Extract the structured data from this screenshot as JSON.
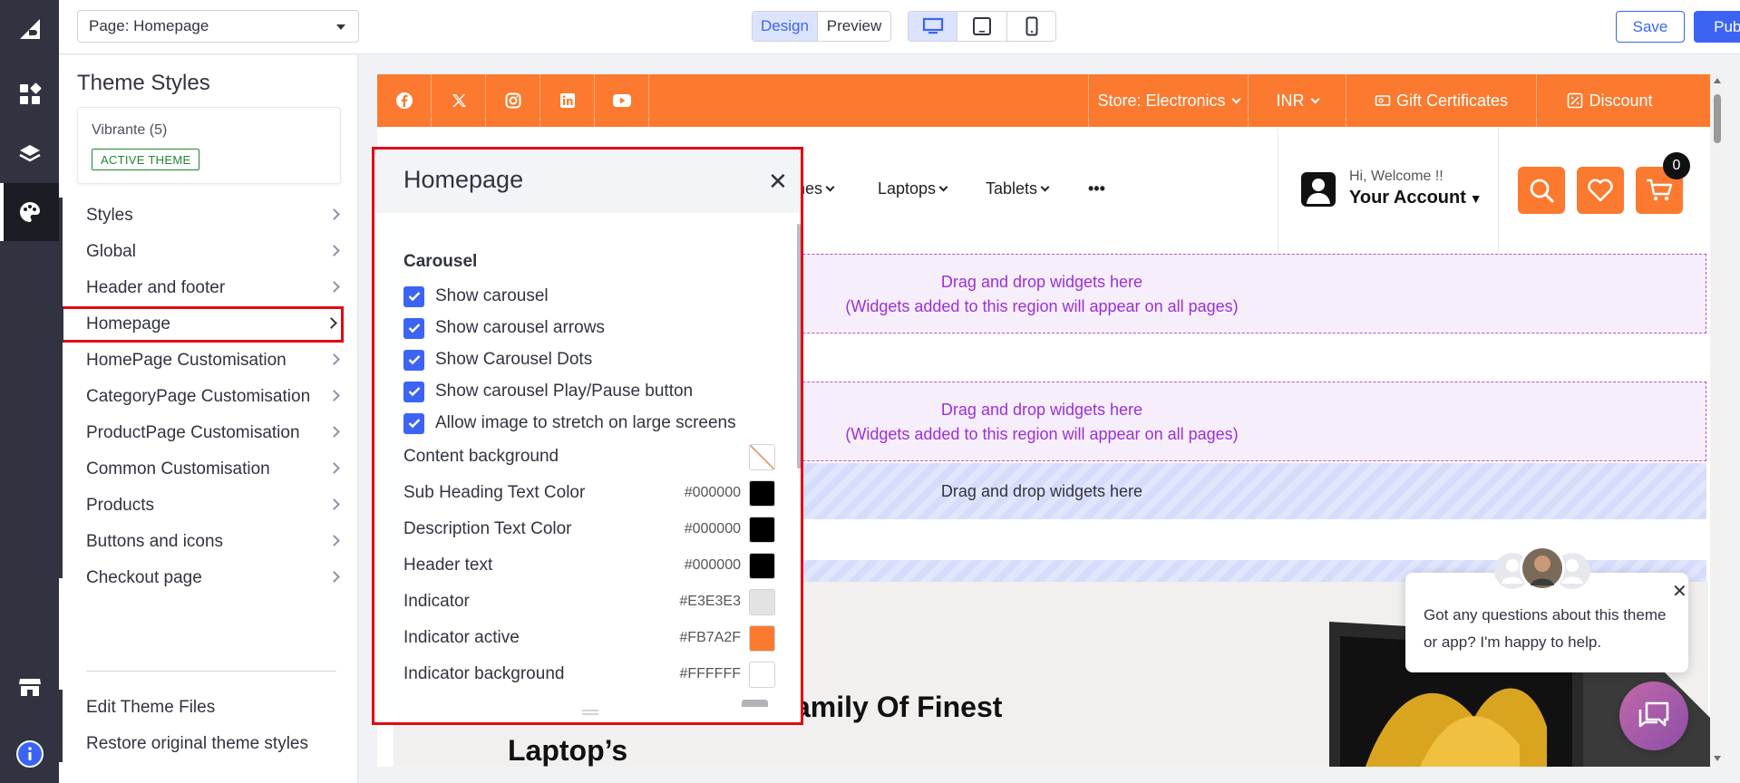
{
  "topbar": {
    "page_select": "Page: Homepage",
    "design_label": "Design",
    "preview_label": "Preview",
    "save_label": "Save",
    "publish_label": "Publish"
  },
  "sidebar": {
    "title": "Theme Styles",
    "theme_name": "Vibrante (5)",
    "theme_badge": "ACTIVE THEME",
    "items": [
      {
        "label": "Styles"
      },
      {
        "label": "Global"
      },
      {
        "label": "Header and footer"
      },
      {
        "label": "Homepage"
      },
      {
        "label": "HomePage Customisation"
      },
      {
        "label": "CategoryPage Customisation"
      },
      {
        "label": "ProductPage Customisation"
      },
      {
        "label": "Common Customisation"
      },
      {
        "label": "Products"
      },
      {
        "label": "Buttons and icons"
      },
      {
        "label": "Checkout page"
      }
    ],
    "edit_files": "Edit Theme Files",
    "restore": "Restore original theme styles"
  },
  "preview": {
    "store": "Store: Electronics",
    "currency": "INR",
    "gift": "Gift Certificates",
    "discount": "Discount",
    "nav": [
      "nes",
      "Laptops",
      "Tablets"
    ],
    "more": "•••",
    "welcome": "Hi, Welcome !!",
    "account": "Your Account",
    "cart_count": "0",
    "drop1_line1": "Drag and drop widgets here",
    "drop1_line2": "(Widgets added to this region will appear on all pages)",
    "drop2_line1": "Drag and drop widgets here",
    "drop2_line2": "(Widgets added to this region will appear on all pages)",
    "drop3": "Drag and drop widgets here",
    "hero_line1": "amily Of Finest",
    "hero_line2": "Laptop’s",
    "chat_text": "Got any questions about this theme or app? I'm happy to help."
  },
  "panel": {
    "title": "Homepage",
    "section": "Carousel",
    "checkboxes": [
      "Show carousel",
      "Show carousel arrows",
      "Show Carousel Dots",
      "Show carousel Play/Pause button",
      "Allow image to stretch on large screens"
    ],
    "colors": [
      {
        "label": "Content background",
        "hex": "",
        "color": "transparent"
      },
      {
        "label": "Sub Heading Text Color",
        "hex": "#000000",
        "color": "#000000"
      },
      {
        "label": "Description Text Color",
        "hex": "#000000",
        "color": "#000000"
      },
      {
        "label": "Header text",
        "hex": "#000000",
        "color": "#000000"
      },
      {
        "label": "Indicator",
        "hex": "#E3E3E3",
        "color": "#E3E3E3"
      },
      {
        "label": "Indicator active",
        "hex": "#FB7A2F",
        "color": "#FB7A2F"
      },
      {
        "label": "Indicator background",
        "hex": "#FFFFFF",
        "color": "#FFFFFF"
      }
    ]
  },
  "colors": {
    "accent": "#3c64f4",
    "brand_orange": "#fb7a2f",
    "highlight": "#e30613",
    "rail": "#313440"
  }
}
